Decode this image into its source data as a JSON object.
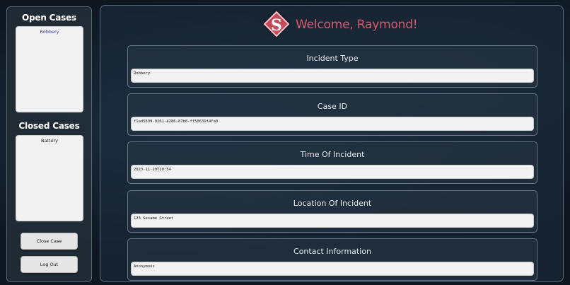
{
  "sidebar": {
    "open_title": "Open Cases",
    "open_cases": [
      "Robbery"
    ],
    "closed_title": "Closed Cases",
    "closed_cases": [
      "Battery"
    ],
    "close_case_label": "Close Case",
    "logout_label": "Log Out"
  },
  "header": {
    "logo_letter": "S",
    "welcome": "Welcome, Raymond!"
  },
  "fields": [
    {
      "label": "Incident Type",
      "value": "Robbery"
    },
    {
      "label": "Case ID",
      "value": "f1ad5539-9261-4286-87b8-ff50639f4fa0"
    },
    {
      "label": "Time Of Incident",
      "value": "2023-11-29T20:54"
    },
    {
      "label": "Location Of Incident",
      "value": "123 Sesame Street"
    },
    {
      "label": "Contact Information",
      "value": "Anonymous"
    }
  ],
  "colors": {
    "accent": "#d9596b",
    "logo_fill": "#c44a5a",
    "open_case_text": "#3b3ea8"
  }
}
